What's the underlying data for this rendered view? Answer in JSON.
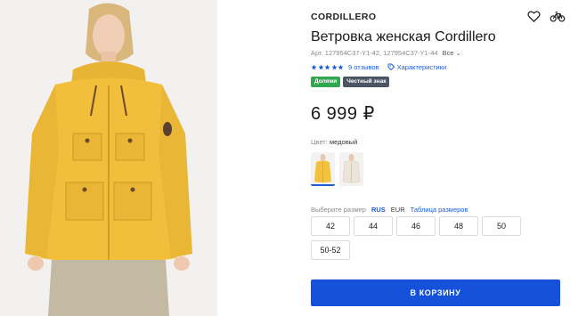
{
  "product": {
    "brand": "CORDILLERO",
    "title": "Ветровка женская Cordillero",
    "article": "Арт. 127954C37-Y1-42, 127954C37-Y1-44",
    "article_all": "Все",
    "rating": 5,
    "reviews": "9 отзывов",
    "characteristics": "Характеристики",
    "badges": [
      "Долями",
      "Честный знак"
    ],
    "price": "6 999 ₽",
    "color_label": "Цвет:",
    "color_value": "медовый",
    "swatches": [
      {
        "name": "yellow jacket",
        "color": "#f2c23e",
        "selected": true
      },
      {
        "name": "beige jacket",
        "color": "#ece4d8",
        "selected": false
      }
    ]
  },
  "sizes": {
    "label": "Выберите размер",
    "systems": [
      "RUS",
      "EUR"
    ],
    "active_system": "RUS",
    "table_link": "Таблица размеров",
    "options": [
      "42",
      "44",
      "46",
      "48",
      "50",
      "50-52"
    ]
  },
  "cart": {
    "label": "В КОРЗИНУ"
  },
  "icons": {
    "favorite": "heart-icon",
    "compare": "bicycle-icon",
    "characteristics": "tag-icon",
    "star": "star-icon"
  },
  "colors": {
    "accent": "#1652d9",
    "link": "#1a5dd8",
    "badge_green": "#2fa84f",
    "badge_dark": "#4b5563",
    "star": "#1a5dd8"
  }
}
